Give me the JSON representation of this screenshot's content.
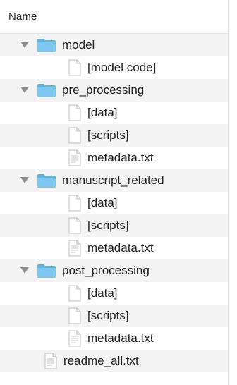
{
  "header": {
    "name_label": "Name"
  },
  "colors": {
    "folder": "#5ab4ec",
    "folder_tab": "#7cc6f2",
    "row_alt": "#f4f4f4"
  },
  "tree": [
    {
      "label": "model",
      "type": "folder",
      "expanded": true,
      "icon": "folder-icon"
    },
    {
      "label": "[model code]",
      "type": "document",
      "icon": "blank-document-icon"
    },
    {
      "label": "pre_processing",
      "type": "folder",
      "expanded": true,
      "icon": "folder-icon"
    },
    {
      "label": "[data]",
      "type": "document",
      "icon": "blank-document-icon"
    },
    {
      "label": "[scripts]",
      "type": "document",
      "icon": "blank-document-icon"
    },
    {
      "label": "metadata.txt",
      "type": "text",
      "icon": "text-document-icon"
    },
    {
      "label": "manuscript_related",
      "type": "folder",
      "expanded": true,
      "icon": "folder-icon"
    },
    {
      "label": "[data]",
      "type": "document",
      "icon": "blank-document-icon"
    },
    {
      "label": "[scripts]",
      "type": "document",
      "icon": "blank-document-icon"
    },
    {
      "label": "metadata.txt",
      "type": "text",
      "icon": "text-document-icon"
    },
    {
      "label": "post_processing",
      "type": "folder",
      "expanded": true,
      "icon": "folder-icon"
    },
    {
      "label": "[data]",
      "type": "document",
      "icon": "blank-document-icon"
    },
    {
      "label": "[scripts]",
      "type": "document",
      "icon": "blank-document-icon"
    },
    {
      "label": "metadata.txt",
      "type": "text",
      "icon": "text-document-icon"
    },
    {
      "label": "readme_all.txt",
      "type": "text",
      "icon": "text-document-icon"
    }
  ]
}
